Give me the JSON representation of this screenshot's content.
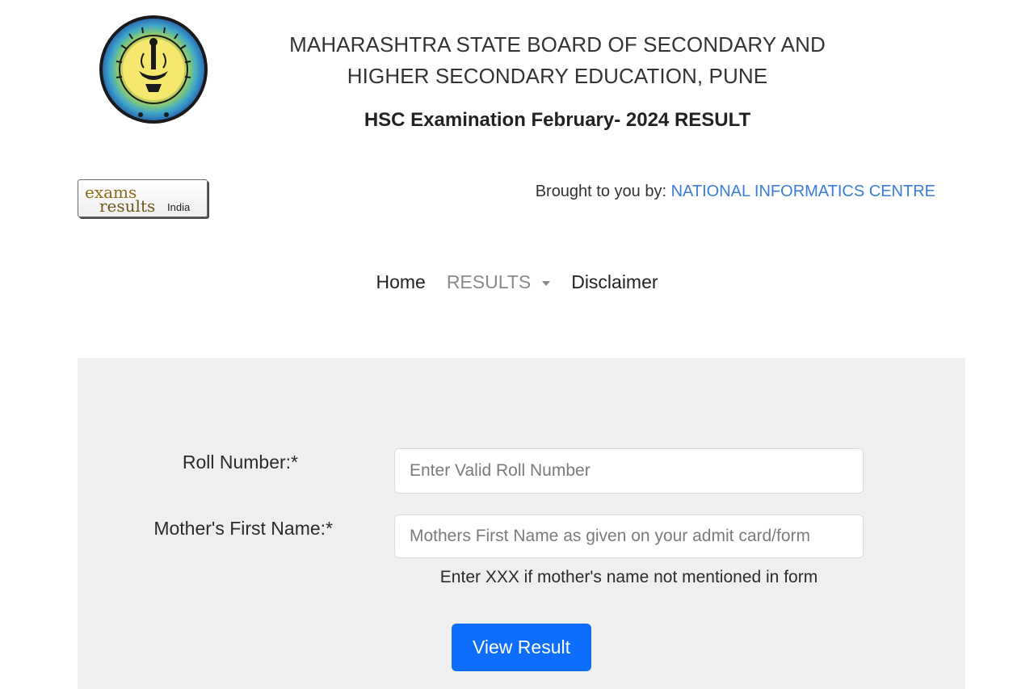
{
  "header": {
    "board_line1": "MAHARASHTRA STATE BOARD OF SECONDARY AND",
    "board_line2": "HIGHER SECONDARY EDUCATION, PUNE",
    "exam_title": "HSC Examination February- 2024 RESULT",
    "seal_icon": "board-seal-icon"
  },
  "partner_logo": {
    "line1": "exams",
    "line2": "results",
    "line3": "India"
  },
  "credit": {
    "prefix": "Brought to you by: ",
    "organisation": "NATIONAL INFORMATICS CENTRE"
  },
  "nav": {
    "home": "Home",
    "results": "RESULTS",
    "disclaimer": "Disclaimer"
  },
  "form": {
    "roll_label": "Roll Number:*",
    "roll_placeholder": "Enter Valid Roll Number",
    "roll_value": "",
    "mother_label": "Mother's First Name:*",
    "mother_placeholder": "Mothers First Name as given on your admit card/form",
    "mother_value": "",
    "mother_hint": "Enter XXX if mother's name not mentioned in form",
    "submit_label": "View Result"
  },
  "colors": {
    "link": "#3b7dd8",
    "button": "#0d6efd",
    "panel": "#efefef"
  }
}
